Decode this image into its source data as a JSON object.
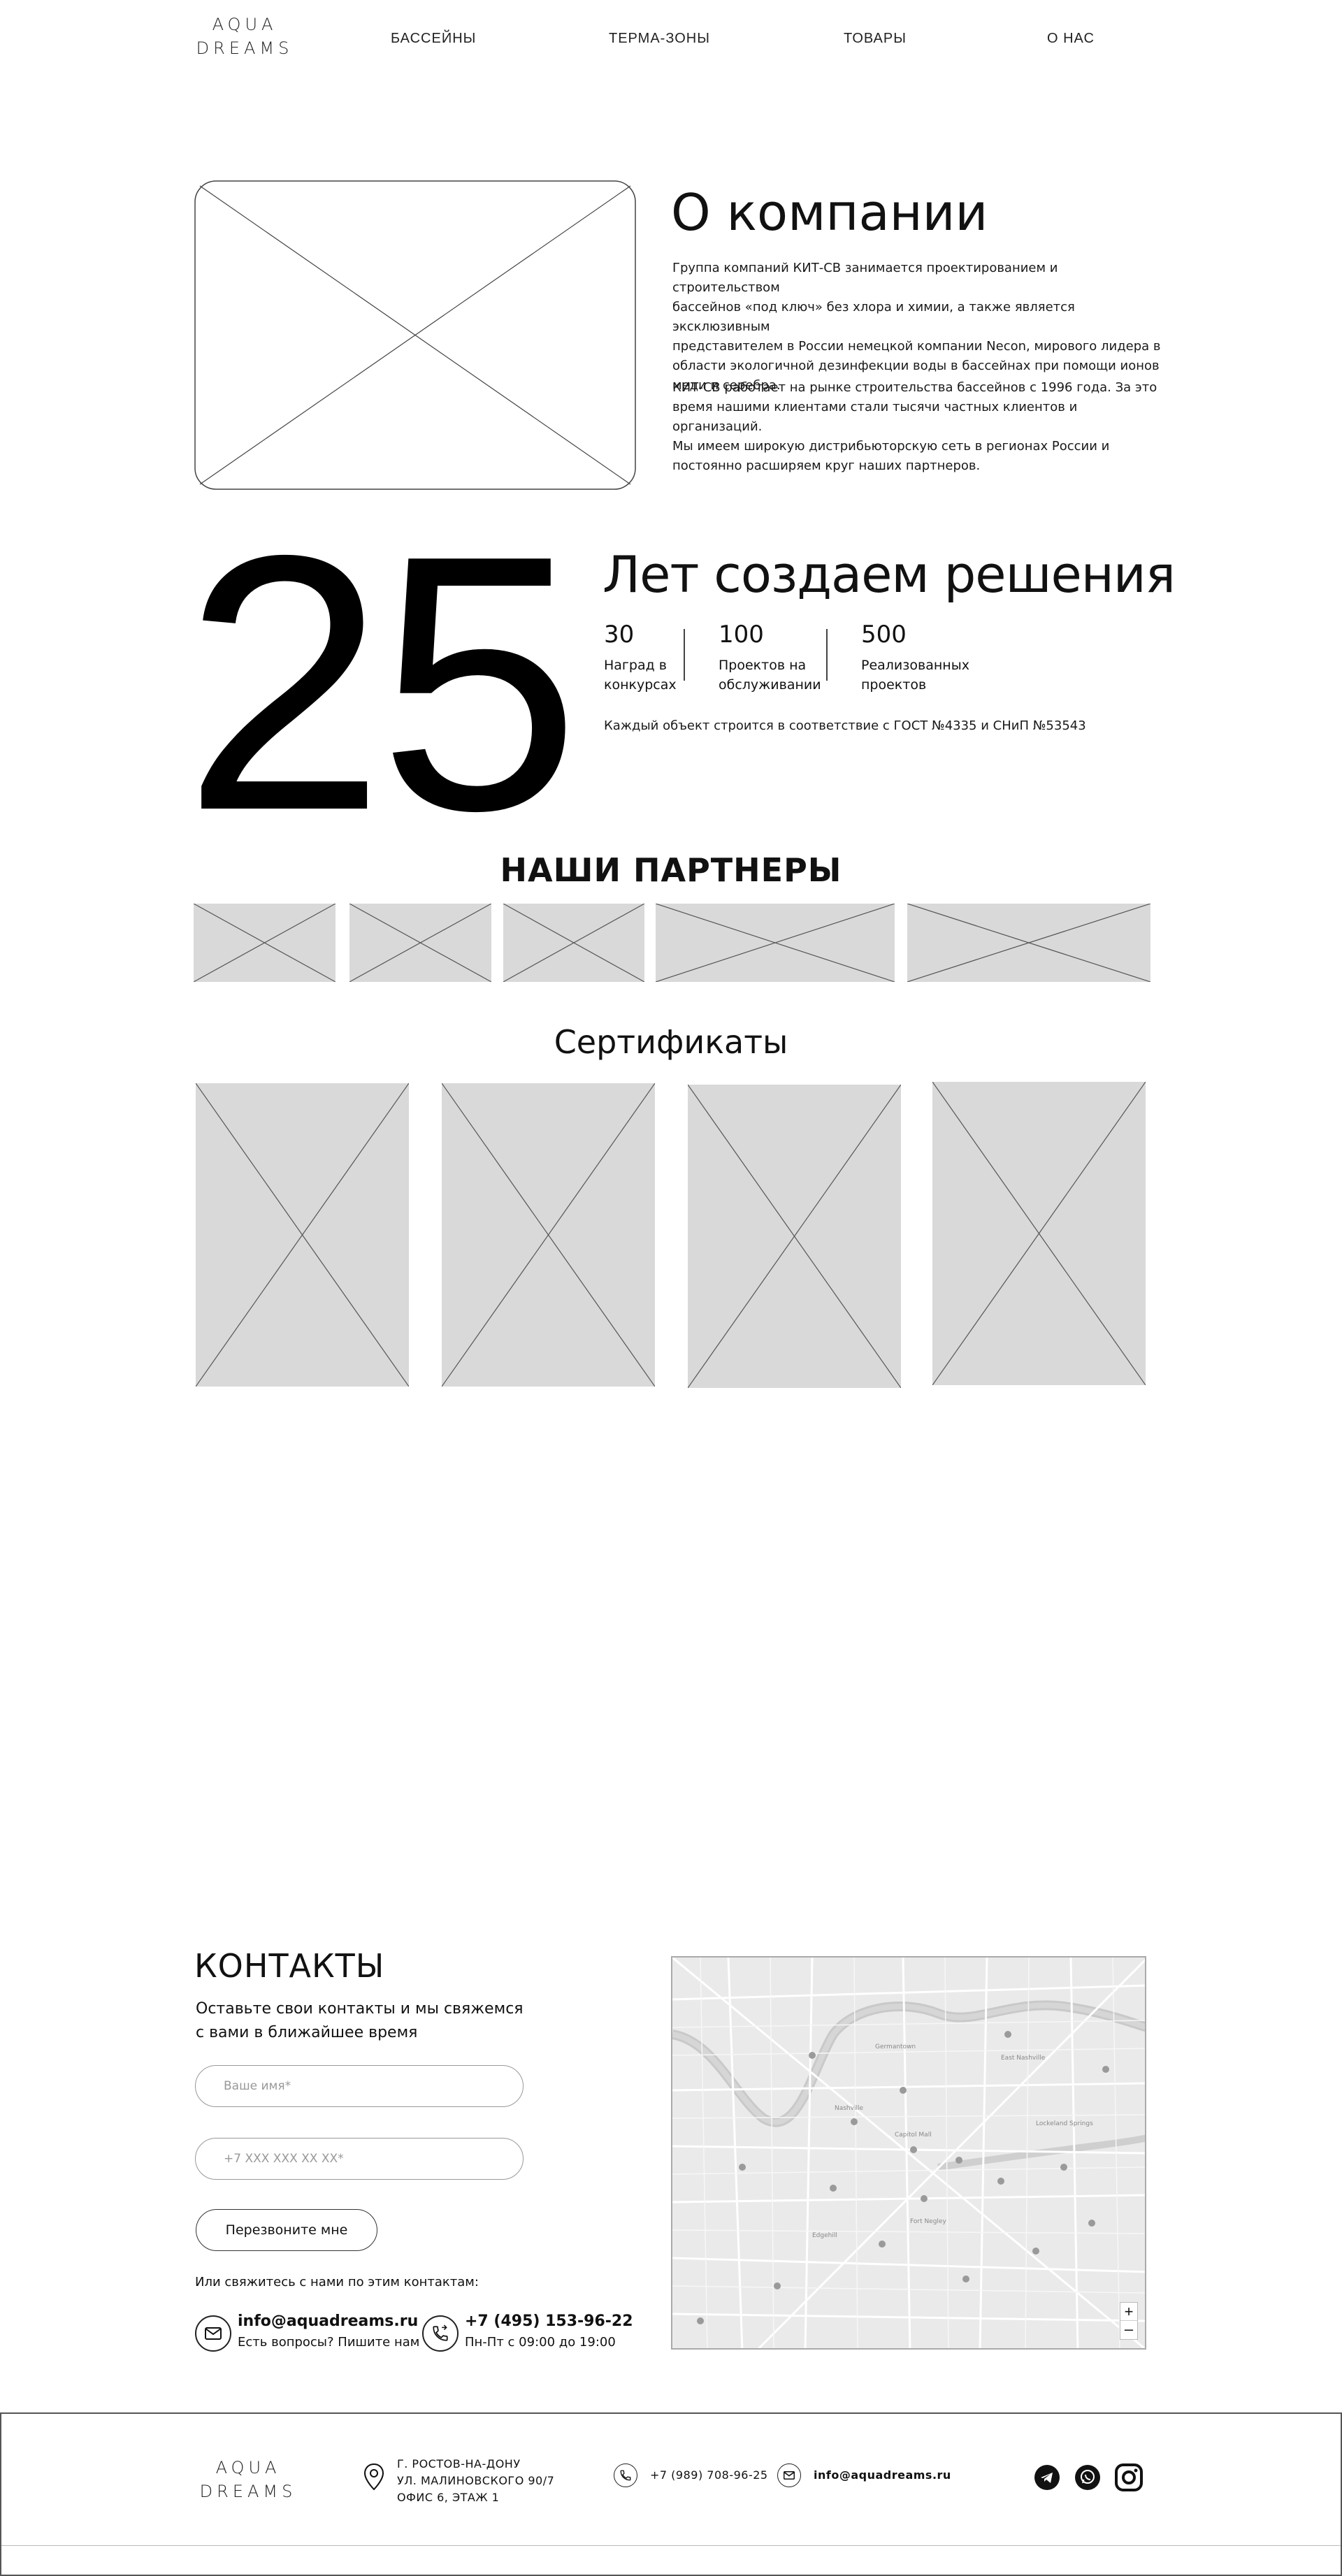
{
  "header": {
    "logo_line1": "AQUA",
    "logo_line2": "DREAMS",
    "nav": [
      "БАССЕЙНЫ",
      "ТЕРМА-ЗОНЫ",
      "ТОВАРЫ",
      "О НАС"
    ]
  },
  "about": {
    "title": "О компании",
    "paragraphs": [
      [
        "Группа компаний КИТ-СВ занимается проектированием и строительством",
        "бассейнов «под ключ» без хлора и химии, а также является эксклюзивным",
        "представителем в России немецкой компании Necon, мирового лидера в",
        "области экологичной дезинфекции воды в бассейнах при помощи ионов",
        "меди и серебра."
      ],
      [
        "КИТ-СВ работает на рынке строительства бассейнов с 1996 года. За это",
        "время нашими клиентами стали тысячи частных клиентов и организаций.",
        "Мы имеем широкую дистрибьюторскую сеть в регионах России и",
        "постоянно расширяем круг наших партнеров."
      ]
    ]
  },
  "years": {
    "big_number": "25",
    "title": "Лет создаем решения",
    "stats": [
      {
        "value": "30",
        "label_1": "Наград в",
        "label_2": "конкурсах"
      },
      {
        "value": "100",
        "label_1": "Проектов на",
        "label_2": "обслуживании"
      },
      {
        "value": "500",
        "label_1": "Реализованных",
        "label_2": "проектов"
      }
    ],
    "note": "Каждый объект строится в соответствие с ГОСТ №4335 и СНиП №53543"
  },
  "partners": {
    "title": "НАШИ ПАРТНЕРЫ"
  },
  "certificates": {
    "title": "Сертификаты"
  },
  "contacts": {
    "title": "КОНТАКТЫ",
    "subtitle_1": "Оставьте свои контакты и мы свяжемся",
    "subtitle_2": "с вами в ближайшее время",
    "name_placeholder": "Ваше имя*",
    "phone_placeholder": "+7 XXX XXX XX XX*",
    "button": "Перезвоните мне",
    "alt_text": "Или свяжитесь с нами по этим контактам:",
    "email": "info@aquadreams.ru",
    "email_sub": "Есть вопросы? Пишите нам",
    "phone": "+7 (495) 153-96-22",
    "phone_sub": "Пн-Пт с 09:00 до 19:00"
  },
  "map": {
    "zoom_in": "+",
    "zoom_out": "–",
    "labels": [
      "Fort Negley",
      "Nashville",
      "Capitol Mall",
      "East Nashville",
      "Germantown",
      "Edgehill",
      "Lockeland Springs"
    ]
  },
  "footer": {
    "logo_line1": "AQUA",
    "logo_line2": "DREAMS",
    "address": [
      "Г. РОСТОВ-НА-ДОНУ",
      "УЛ. МАЛИНОВСКОГО 90/7",
      "ОФИС 6, ЭТАЖ 1"
    ],
    "phone": "+7 (989) 708-96-25",
    "email": "info@aquadreams.ru",
    "icons": [
      "telegram-icon",
      "whatsapp-icon",
      "instagram-icon"
    ]
  }
}
